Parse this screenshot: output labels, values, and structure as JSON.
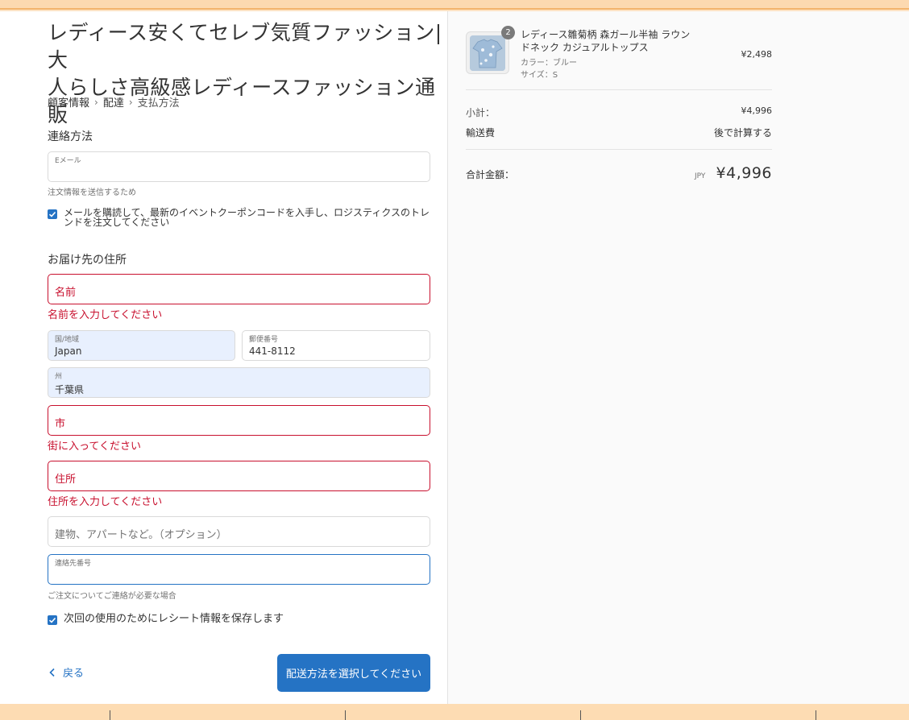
{
  "store": {
    "title_line1": "レディース安くてセレブ気質ファッション|大",
    "title_line2": "人らしさ高級感レディースファッション通販"
  },
  "breadcrumb": {
    "items": [
      "顧客情報",
      "配達",
      "支払方法"
    ]
  },
  "contact": {
    "heading": "連絡方法",
    "email_label": "Eメール",
    "email_value": "",
    "email_hint": "注文情報を送信するため",
    "newsletter_label": "メールを購読して、最新のイベントクーポンコードを入手し、ロジスティクスのトレンドを注文してください",
    "newsletter_checked": true
  },
  "shipping": {
    "heading": "お届け先の住所",
    "name_placeholder": "名前",
    "name_error": "名前を入力してください",
    "country_label": "国/地域",
    "country_value": "Japan",
    "postal_label": "郵便番号",
    "postal_value": "441-8112",
    "state_label": "州",
    "state_value": "千葉県",
    "city_placeholder": "市",
    "city_error": "街に入ってください",
    "address_placeholder": "住所",
    "address_error": "住所を入力してください",
    "apartment_placeholder": "建物、アパートなど。（オプション）",
    "phone_label": "連絡先番号",
    "phone_hint": "ご注文についてご連絡が必要な場合",
    "save_label": "次回の使用のためにレシート情報を保存します",
    "save_checked": true
  },
  "actions": {
    "back_label": "戻る",
    "continue_label": "配送方法を選択してください"
  },
  "order": {
    "item": {
      "name": "レディース雛菊柄 森ガール半袖 ラウンドネック カジュアルトップス",
      "color": "カラー：ブルー",
      "size": "サイズ：S",
      "quantity": "2",
      "price": "¥2,498"
    },
    "subtotal_label": "小計：",
    "subtotal_value": "¥4,996",
    "shipping_label": "輸送費",
    "shipping_value": "後で計算する",
    "total_label": "合計金額：",
    "total_currency": "JPY",
    "total_value": "¥4,996"
  },
  "colors": {
    "accent": "#2573c4",
    "error": "#c8102e",
    "autofill": "#e8f0fe"
  }
}
